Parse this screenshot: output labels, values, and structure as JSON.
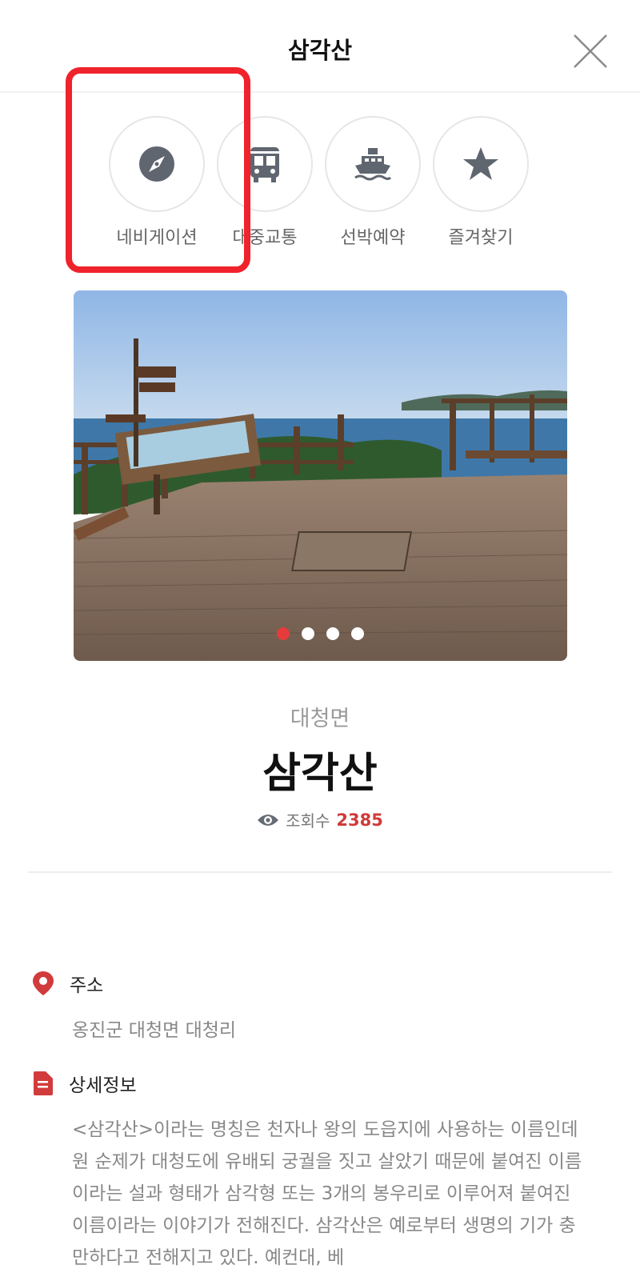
{
  "header": {
    "title": "삼각산"
  },
  "actions": [
    {
      "label": "네비게이션",
      "icon": "compass-icon"
    },
    {
      "label": "대중교통",
      "icon": "bus-icon"
    },
    {
      "label": "선박예약",
      "icon": "ship-icon"
    },
    {
      "label": "즐겨찾기",
      "icon": "star-icon"
    }
  ],
  "gallery": {
    "count": 4,
    "active_index": 0
  },
  "place": {
    "region": "대청면",
    "name": "삼각산",
    "views_label": "조회수",
    "views_count": "2385"
  },
  "address": {
    "label": "주소",
    "value": "옹진군 대청면 대청리"
  },
  "detail": {
    "label": "상세정보",
    "text": "<삼각산>이라는 명칭은 천자나 왕의 도읍지에 사용하는 이름인데 원 순제가 대청도에 유배되 궁궐을 짓고 살았기 때문에 붙여진 이름이라는 설과 형태가 삼각형 또는 3개의 봉우리로 이루어져 붙여진 이름이라는 이야기가 전해진다. 삼각산은 예로부터 생명의 기가 충만하다고 전해지고 있다. 예컨대, 베"
  },
  "colors": {
    "accent": "#d03a3a",
    "highlight": "#f0222b",
    "icon": "#5f6670"
  }
}
